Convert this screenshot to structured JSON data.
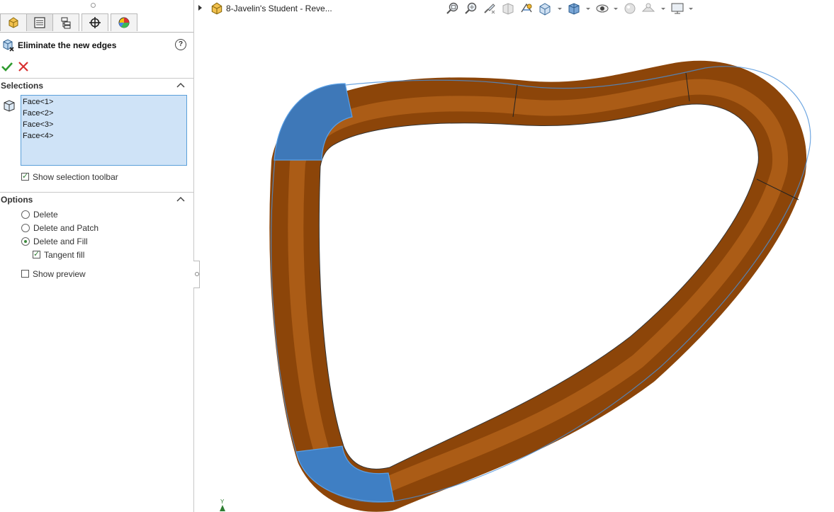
{
  "panel": {
    "tabs": [
      {
        "name": "feature-manager-tab",
        "icon": "part-tree-icon"
      },
      {
        "name": "property-manager-tab",
        "icon": "property-list-icon"
      },
      {
        "name": "configuration-manager-tab",
        "icon": "configuration-icon"
      },
      {
        "name": "dimxpert-tab",
        "icon": "crosshair-icon"
      },
      {
        "name": "display-manager-tab",
        "icon": "color-pie-icon"
      }
    ],
    "title": "Eliminate the new edges",
    "help_icon_text": "?",
    "selections": {
      "heading": "Selections",
      "items": [
        "Face<1>",
        "Face<2>",
        "Face<3>",
        "Face<4>"
      ],
      "show_toolbar_label": "Show selection toolbar",
      "show_toolbar_checked": true
    },
    "options": {
      "heading": "Options",
      "radios": [
        {
          "label": "Delete",
          "selected": false
        },
        {
          "label": "Delete and Patch",
          "selected": false
        },
        {
          "label": "Delete and Fill",
          "selected": true
        }
      ],
      "tangent_fill_label": "Tangent fill",
      "tangent_fill_checked": true,
      "show_preview_label": "Show preview",
      "show_preview_checked": false
    }
  },
  "document": {
    "name": "8-Javelin's Student - Reve..."
  },
  "view_toolbar": {
    "tools": [
      "zoom-to-fit-icon",
      "zoom-to-area-icon",
      "previous-view-icon",
      "section-view-icon",
      "dynamic-annotation-icon",
      "view-orientation-icon",
      "display-style-icon",
      "hide-show-icon",
      "edit-appearance-icon",
      "apply-scene-icon",
      "view-settings-icon"
    ]
  },
  "colors": {
    "accent": "#4a90d9",
    "selected_face": "#3e78b8",
    "tube": "#9a4c0a",
    "selection_bg": "#cfe3f7",
    "ok_green": "#2e9a2e",
    "cancel_red": "#d83030"
  },
  "triad_label": "Y"
}
